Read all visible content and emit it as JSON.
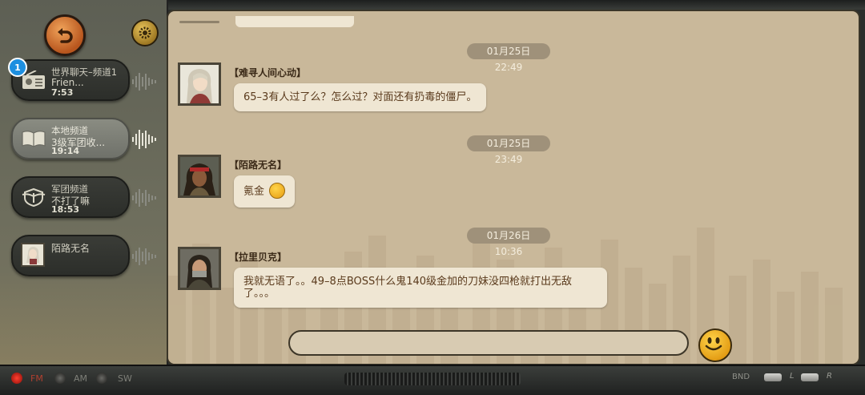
{
  "channels": [
    {
      "line1": "世界聊天–频道1",
      "line2": "Frien...",
      "line3": "7:53",
      "badge": "1",
      "icon": "radio-icon"
    },
    {
      "line1": "本地频道",
      "line2": "3级军团收...",
      "line3": "19:14",
      "icon": "book-icon",
      "active": true
    },
    {
      "line1": "军团频道",
      "line2": "不打了嘛",
      "line3": "18:53",
      "icon": "legion-emblem-icon"
    },
    {
      "line1": "陌路无名",
      "line2": "",
      "line3": "",
      "icon": "avatar"
    }
  ],
  "messages": [
    {
      "time": "01月25日 22:49",
      "sender": "【难寻人间心动】",
      "text": "65–3有人过了么？怎么过？对面还有扔毒的僵尸。"
    },
    {
      "time": "01月25日 23:49",
      "sender": "【陌路无名】",
      "text": "氪金"
    },
    {
      "time": "01月26日 10:36",
      "sender": "【拉里贝克】",
      "text": "我就无语了。。49–8点BOSS什么鬼140级金加的刀妹没四枪就打出无敌了。。。"
    }
  ],
  "footer": {
    "fm": "FM",
    "am": "AM",
    "sw": "SW",
    "bnd": "BND",
    "l": "L",
    "r": "R"
  },
  "colors": {
    "panel": "#c9b89a",
    "bubble": "#efe6d3",
    "accent": "#1d8fe0",
    "text": "#5a3a1c"
  }
}
